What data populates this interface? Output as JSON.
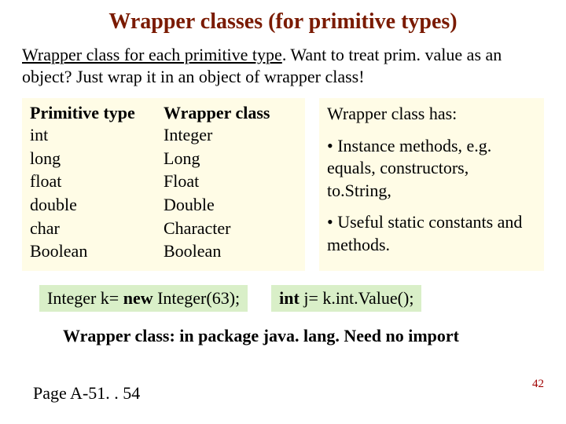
{
  "title": "Wrapper classes (for primitive types)",
  "intro": {
    "underlined": "Wrapper class for each primitive type",
    "rest": ". Want to treat prim. value as an object? Just wrap it in an object of wrapper class!"
  },
  "table": {
    "head1": "Primitive type",
    "head2": "Wrapper class",
    "rows": [
      {
        "prim": "int",
        "wrap": "Integer"
      },
      {
        "prim": "long",
        "wrap": "Long"
      },
      {
        "prim": "float",
        "wrap": "Float"
      },
      {
        "prim": "double",
        "wrap": "Double"
      },
      {
        "prim": "char",
        "wrap": "Character"
      },
      {
        "prim": "Boolean",
        "wrap": "Boolean"
      }
    ]
  },
  "right": {
    "heading": "Wrapper class has:",
    "bullet1": "• Instance methods, e.g. equals, constructors, to.String,",
    "bullet2": "• Useful static constants and methods."
  },
  "snippet1": {
    "part1": "Integer k= ",
    "boldnew": "new",
    "part2": " Integer(63);"
  },
  "snippet2": {
    "boldint": "int",
    "rest": " j= k.int.Value();"
  },
  "footer": "Wrapper class: in package java. lang. Need no import",
  "pageref": "Page A-51. . 54",
  "slidenum": "42"
}
